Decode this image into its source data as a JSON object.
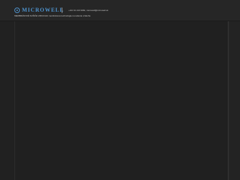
{
  "header": {
    "logo_text": "MICROWELL",
    "contact": "+421 91 210 9382, microwell@microwell.sk",
    "tagline": "MEMBRÁNOVÉ SUŠIČE VZDUCHU membránové technológie na sušenie vzduchu"
  },
  "colors": {
    "background": "#212121",
    "header_background": "#262626",
    "brand_blue": "#4f94cf"
  },
  "icons": {
    "logo": "microwell-logo-icon"
  }
}
